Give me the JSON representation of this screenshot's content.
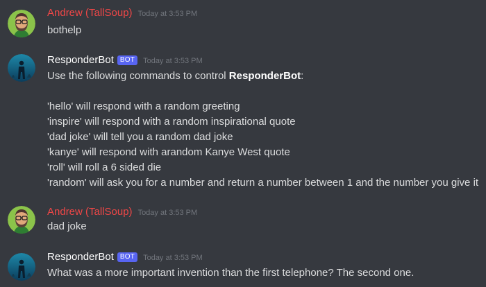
{
  "colors": {
    "background": "#36393f",
    "user_name": "#f04747",
    "bot_name": "#ffffff",
    "bot_badge": "#5865f2",
    "timestamp": "#72767d",
    "text": "#dcddde"
  },
  "messages": [
    {
      "author": "Andrew (TallSoup)",
      "timestamp": "Today at 3:53 PM",
      "avatar": "bearded-man-avatar",
      "lines": [
        "bothelp"
      ]
    },
    {
      "author": "ResponderBot",
      "badge": "BOT",
      "timestamp": "Today at 3:53 PM",
      "avatar": "bot-avatar",
      "intro_prefix": "Use the following commands to control ",
      "intro_bold": "ResponderBot",
      "intro_suffix": ":",
      "commands": [
        "'hello' will respond with a random greeting",
        "'inspire' will respond with a random inspirational quote",
        "'dad joke' will tell you a random dad joke",
        "'kanye' will respond with arandom Kanye West quote",
        "'roll' will roll a 6 sided die",
        "'random' will ask you for a number and return a number between 1 and the number you give it"
      ]
    },
    {
      "author": "Andrew (TallSoup)",
      "timestamp": "Today at 3:53 PM",
      "avatar": "bearded-man-avatar",
      "lines": [
        "dad joke"
      ]
    },
    {
      "author": "ResponderBot",
      "badge": "BOT",
      "timestamp": "Today at 3:53 PM",
      "avatar": "bot-avatar",
      "lines": [
        "What was a more important invention than the first telephone? The second one."
      ]
    }
  ]
}
